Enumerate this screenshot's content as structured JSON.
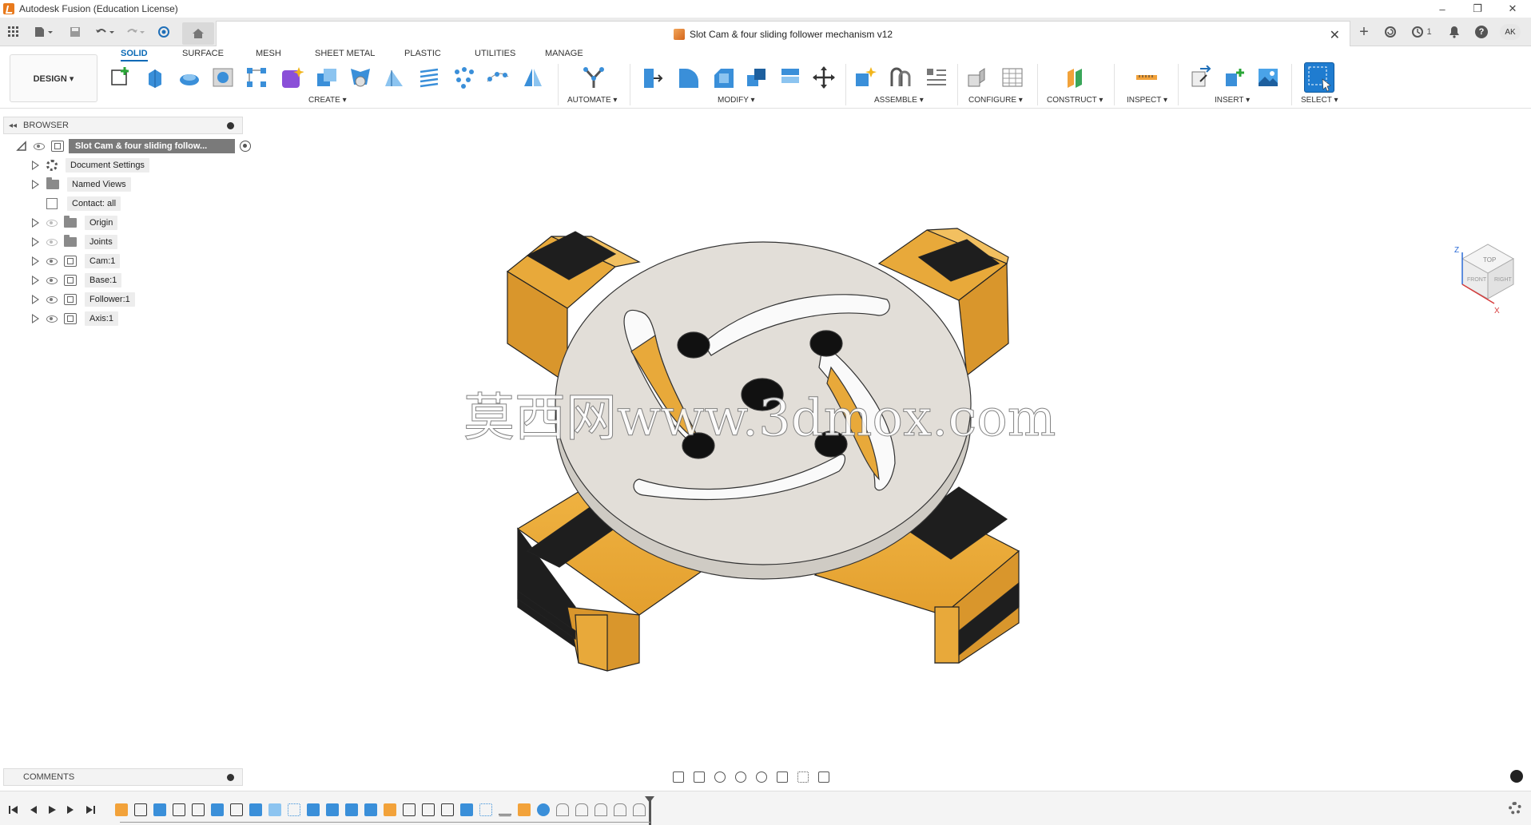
{
  "window": {
    "title": "Autodesk Fusion (Education License)",
    "minimize": "–",
    "restore": "❐",
    "close": "✕"
  },
  "tabbar": {
    "document_title": "Slot Cam & four sliding follower mechanism v12",
    "close_symbol": "✕",
    "plus_symbol": "+",
    "jobs_count": "1",
    "user_initials": "AK",
    "help_symbol": "?"
  },
  "ribbon": {
    "workspace_button": "DESIGN ▾",
    "tabs": [
      "SOLID",
      "SURFACE",
      "MESH",
      "SHEET METAL",
      "PLASTIC",
      "UTILITIES",
      "MANAGE"
    ],
    "active_tab": "SOLID",
    "groups": [
      "CREATE ▾",
      "AUTOMATE ▾",
      "MODIFY ▾",
      "ASSEMBLE ▾",
      "CONFIGURE ▾",
      "CONSTRUCT ▾",
      "INSPECT ▾",
      "INSERT ▾",
      "SELECT ▾"
    ]
  },
  "browser": {
    "header": "BROWSER",
    "root": "Slot Cam & four sliding follow...",
    "items": [
      {
        "label": "Document Settings",
        "icon": "gear-icon"
      },
      {
        "label": "Named Views",
        "icon": "folder-icon"
      },
      {
        "label": "Contact: all",
        "icon": "contact-icon"
      },
      {
        "label": "Origin",
        "icon": "folder-icon"
      },
      {
        "label": "Joints",
        "icon": "folder-icon"
      },
      {
        "label": "Cam:1",
        "icon": "component-icon"
      },
      {
        "label": "Base:1",
        "icon": "component-icon"
      },
      {
        "label": "Follower:1",
        "icon": "component-icon"
      },
      {
        "label": "Axis:1",
        "icon": "component-icon"
      }
    ]
  },
  "comments": {
    "label": "COMMENTS"
  },
  "viewcube": {
    "top": "TOP",
    "front": "FRONT",
    "right": "RIGHT",
    "axis_z": "Z",
    "axis_x": "X"
  },
  "watermark": "莫西网www.3dmox.com",
  "colors": {
    "accent": "#0a6ab6",
    "cam_plate": "#e2ded8",
    "follower": "#e8a93a",
    "base_dark": "#2a2a2a"
  }
}
